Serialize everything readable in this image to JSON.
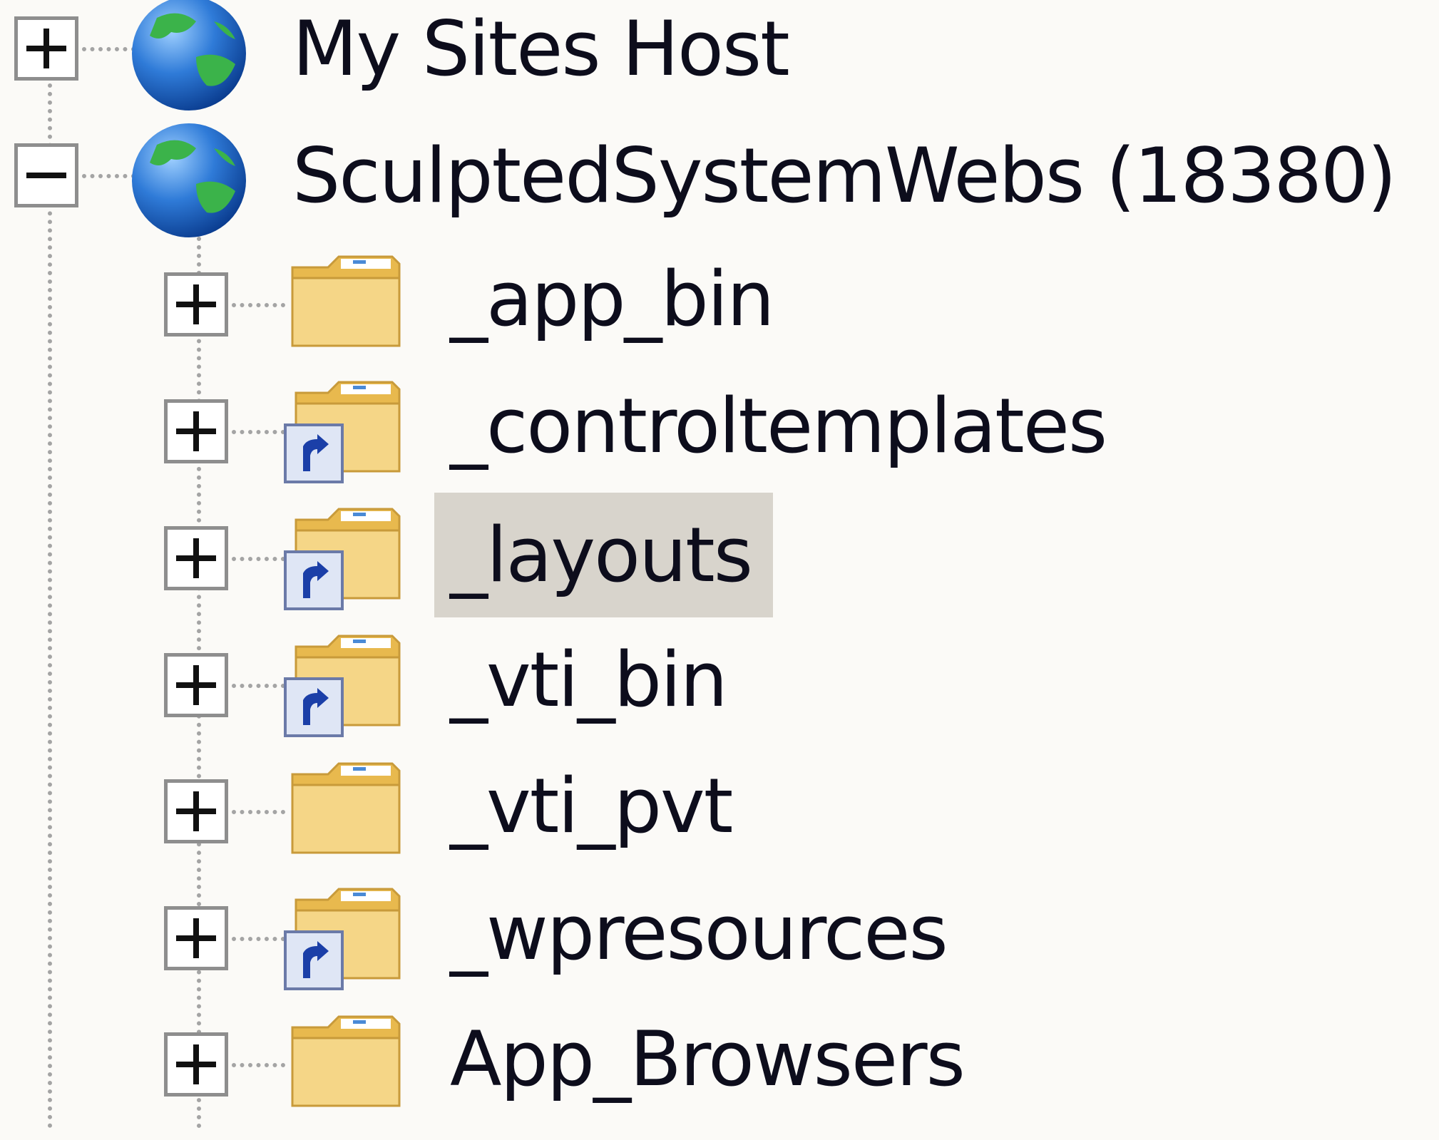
{
  "tree": {
    "nodes": [
      {
        "label": "My Sites Host",
        "icon": "globe-icon",
        "expander": "plus",
        "level": 0
      },
      {
        "label": "SculptedSystemWebs (18380)",
        "icon": "globe-icon",
        "expander": "minus",
        "level": 0
      },
      {
        "label": "_app_bin",
        "icon": "folder-icon",
        "expander": "plus",
        "level": 1,
        "shortcut": false
      },
      {
        "label": "_controltemplates",
        "icon": "folder-shortcut-icon",
        "expander": "plus",
        "level": 1,
        "shortcut": true
      },
      {
        "label": "_layouts",
        "icon": "folder-shortcut-icon",
        "expander": "plus",
        "level": 1,
        "shortcut": true,
        "selected": true
      },
      {
        "label": "_vti_bin",
        "icon": "folder-shortcut-icon",
        "expander": "plus",
        "level": 1,
        "shortcut": true
      },
      {
        "label": "_vti_pvt",
        "icon": "folder-icon",
        "expander": "plus",
        "level": 1,
        "shortcut": false
      },
      {
        "label": "_wpresources",
        "icon": "folder-shortcut-icon",
        "expander": "plus",
        "level": 1,
        "shortcut": true
      },
      {
        "label": "App_Browsers",
        "icon": "folder-icon",
        "expander": "plus",
        "level": 1,
        "shortcut": false
      }
    ]
  },
  "colors": {
    "background": "#fbfaf7",
    "selection": "#d8d4cc",
    "text": "#0d0d1c",
    "folder": "#f3d27a",
    "globe_blue": "#1e63c8",
    "globe_green": "#3bb34a"
  }
}
